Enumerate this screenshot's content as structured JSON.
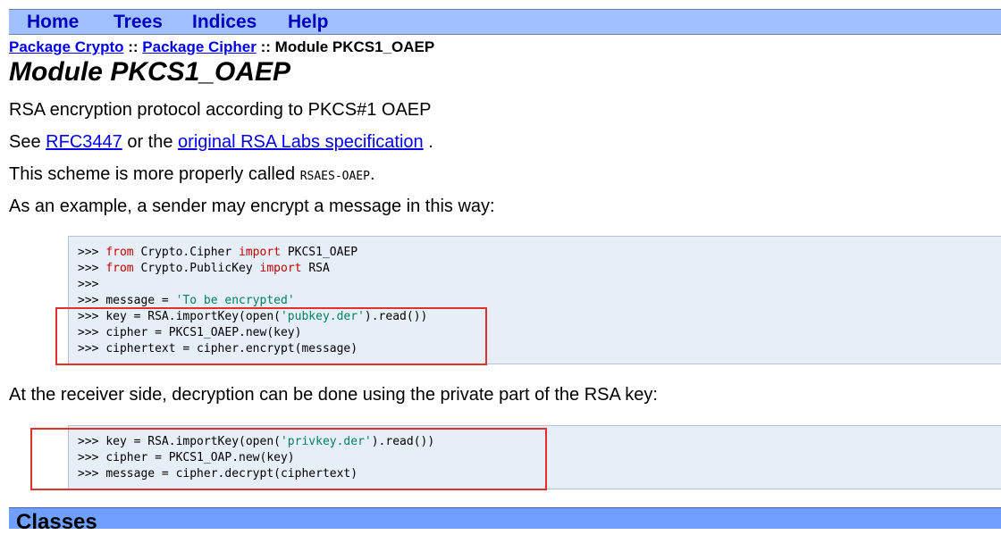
{
  "nav": {
    "home": "Home",
    "trees": "Trees",
    "indices": "Indices",
    "help": "Help"
  },
  "breadcrumb": {
    "crypto": "Package Crypto",
    "sep1": "::",
    "cipher": "Package Cipher",
    "sep2": "::",
    "current": "Module PKCS1_OAEP"
  },
  "title": "Module PKCS1_OAEP",
  "intro": "RSA encryption protocol according to PKCS#1 OAEP",
  "see": {
    "prefix": "See",
    "rfc_link": "RFC3447",
    "middle": "or the",
    "spec_link": "original RSA Labs specification",
    "suffix": "."
  },
  "scheme": {
    "prefix": "This scheme is more properly called",
    "code": "RSAES-OAEP",
    "suffix": "."
  },
  "example_text": "As an example, a sender may encrypt a message in this way:",
  "code1": {
    "prompt": ">>>",
    "l1": {
      "kw1": "from",
      "mod": "Crypto.Cipher",
      "kw2": "import",
      "name": "PKCS1_OAEP"
    },
    "l2": {
      "kw1": "from",
      "mod": "Crypto.PublicKey",
      "kw2": "import",
      "name": "RSA"
    },
    "l4": {
      "pre": "message = ",
      "str": "'To be encrypted'"
    },
    "l5": {
      "pre": "key = RSA.importKey(open(",
      "str": "'pubkey.der'",
      "post": ").read())"
    },
    "l6": "cipher = PKCS1_OAEP.new(key)",
    "l7": "ciphertext = cipher.encrypt(message)"
  },
  "receiver_text": "At the receiver side, decryption can be done using the private part of the RSA key:",
  "code2": {
    "l1": {
      "pre": "key = RSA.importKey(open(",
      "str": "'privkey.der'",
      "post": ").read())"
    },
    "l2": "cipher = PKCS1_OAP.new(key)",
    "l3": "message = cipher.decrypt(ciphertext)"
  },
  "classes_heading": "Classes",
  "colors": {
    "nav_bg": "#a0c0ff",
    "link": "#0000ee",
    "code_bg": "#e6eef7",
    "keyword": "#c00000",
    "string": "#008060",
    "highlight": "#e03030"
  }
}
